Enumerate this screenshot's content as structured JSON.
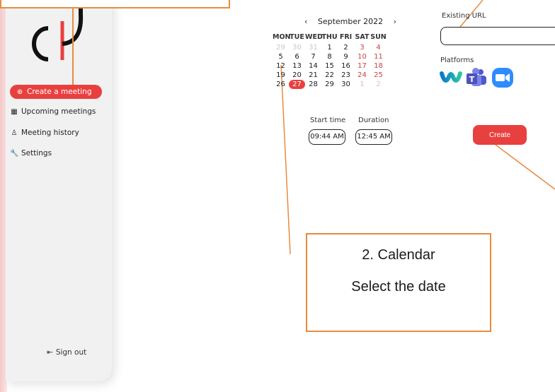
{
  "sidebar": {
    "items": [
      {
        "label": "Create a meeting",
        "icon": "plus-circle-icon",
        "active": true
      },
      {
        "label": "Upcoming meetings",
        "icon": "calendar-icon",
        "active": false
      },
      {
        "label": "Meeting history",
        "icon": "user-icon",
        "active": false
      },
      {
        "label": "Settings",
        "icon": "wrench-icon",
        "active": false
      }
    ],
    "sign_out": "Sign out"
  },
  "calendar": {
    "prev": "‹",
    "next": "›",
    "month_label": "September 2022",
    "weekdays": [
      "MON",
      "TUE",
      "WED",
      "THU",
      "FRI",
      "SAT",
      "SUN"
    ],
    "weeks": [
      [
        "29",
        "30",
        "31",
        "1",
        "2",
        "3",
        "4"
      ],
      [
        "5",
        "6",
        "7",
        "8",
        "9",
        "10",
        "11"
      ],
      [
        "12",
        "13",
        "14",
        "15",
        "16",
        "17",
        "18"
      ],
      [
        "19",
        "20",
        "21",
        "22",
        "23",
        "24",
        "25"
      ],
      [
        "26",
        "27",
        "28",
        "29",
        "30",
        "1",
        "2"
      ]
    ],
    "selected_day": "27"
  },
  "time": {
    "start_label": "Start time",
    "start_value": "09:44 AM",
    "duration_label": "Duration",
    "duration_value": "12:45 AM"
  },
  "url": {
    "label": "Existing URL",
    "value": ""
  },
  "platforms": {
    "label": "Platforms",
    "items": [
      "webex-icon",
      "teams-icon",
      "zoom-icon"
    ]
  },
  "create_label": "Create",
  "annotation": {
    "line1": "2. Calendar",
    "line2": "Select the date"
  },
  "colors": {
    "accent": "#e8403f",
    "annotation": "#e98b3d"
  }
}
